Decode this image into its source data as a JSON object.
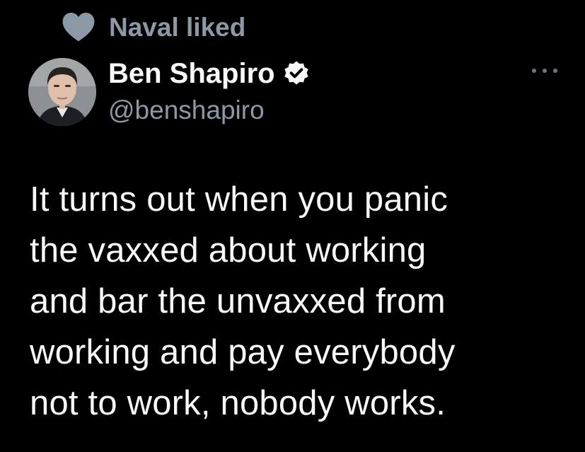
{
  "social_context": {
    "icon": "heart-icon",
    "text": "Naval liked"
  },
  "author": {
    "name": "Ben Shapiro",
    "handle": "@benshapiro",
    "verified": true,
    "avatar_icon": "avatar"
  },
  "more_icon": "more-options-icon",
  "tweet": {
    "lines": [
      "It turns out when you panic",
      "the vaxxed about working",
      "and bar the unvaxxed from",
      "working and pay everybody",
      "not to work, nobody works."
    ]
  },
  "colors": {
    "background": "#000000",
    "primary_text": "#f7f9f9",
    "secondary_text": "#8b98a5",
    "icon_gray": "#6e767d"
  }
}
